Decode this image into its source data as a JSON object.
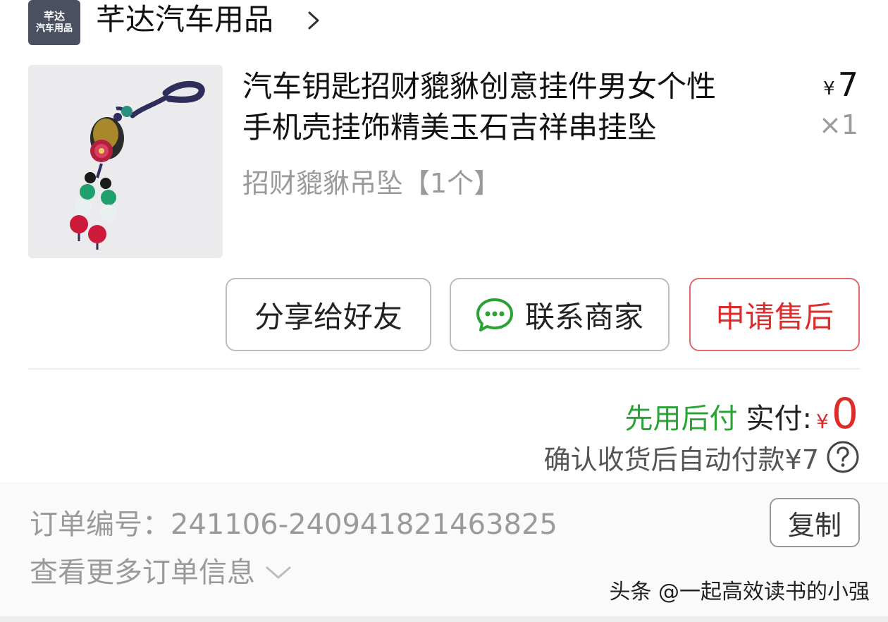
{
  "shop": {
    "logo_line1": "芊达",
    "logo_line2": "汽车用品",
    "name": "芊达汽车用品",
    "chevron_icon": "chevron-right-icon"
  },
  "product": {
    "title_line1": "汽车钥匙招财貔貅创意挂件男女个性",
    "title_line2": "手机壳挂饰精美玉石吉祥串挂坠",
    "spec": "招财貔貅吊坠【1个】",
    "price_symbol": "¥",
    "price": "7",
    "quantity": "×1",
    "image_icon": "pixiu-keychain-image"
  },
  "actions": {
    "share_label": "分享给好友",
    "contact_label": "联系商家",
    "contact_icon": "wechat-chat-icon",
    "after_sale_label": "申请售后"
  },
  "payment": {
    "pay_later": "先用后付",
    "paid_label": "实付:",
    "paid_symbol": "¥",
    "paid_amount": "0",
    "auto_pay_note": "确认收货后自动付款¥7",
    "help_icon": "question-circle-icon"
  },
  "order": {
    "number_text": "订单编号：241106-240941821463825",
    "copy_label": "复制",
    "more_info": "查看更多订单信息",
    "more_icon": "chevron-down-icon"
  },
  "watermark": "头条 @一起高效读书的小强",
  "colors": {
    "green": "#2aa335",
    "red": "#e02b2b",
    "grey_text": "#9a9a9a"
  }
}
